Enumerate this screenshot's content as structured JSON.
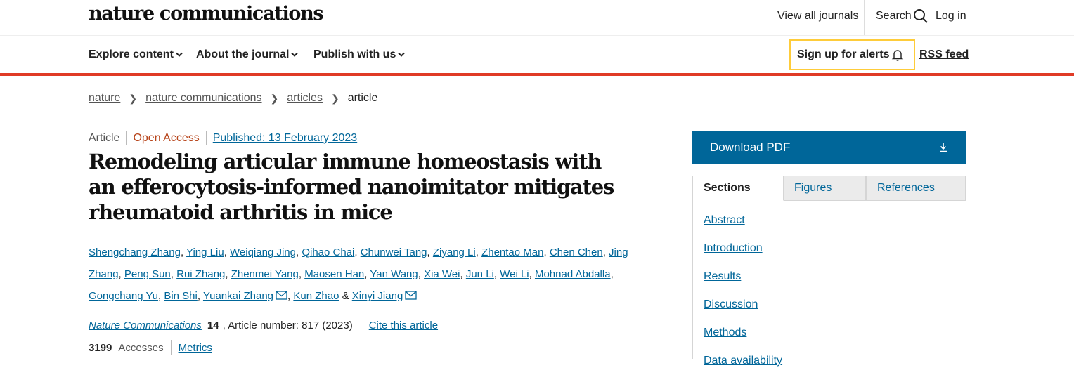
{
  "header": {
    "logo": "nature communications",
    "view_all": "View all journals",
    "search": "Search",
    "login": "Log in"
  },
  "nav": {
    "items": [
      "Explore content",
      "About the journal",
      "Publish with us"
    ],
    "alerts": "Sign up for alerts",
    "rss": "RSS feed"
  },
  "breadcrumb": [
    "nature",
    "nature communications",
    "articles",
    "article"
  ],
  "article": {
    "type": "Article",
    "access": "Open Access",
    "published": "Published: 13 February 2023",
    "title": "Remodeling articular immune homeostasis with an efferocytosis-informed nanoimitator mitigates rheumatoid arthritis in mice",
    "authors": [
      {
        "name": "Shengchang Zhang",
        "sep": ", "
      },
      {
        "name": "Ying Liu",
        "sep": ", "
      },
      {
        "name": "Weiqiang Jing",
        "sep": ", "
      },
      {
        "name": "Qihao Chai",
        "sep": ", "
      },
      {
        "name": "Chunwei Tang",
        "sep": ", "
      },
      {
        "name": "Ziyang Li",
        "sep": ", "
      },
      {
        "name": "Zhentao Man",
        "sep": ", "
      },
      {
        "name": "Chen Chen",
        "sep": ", "
      },
      {
        "name": "Jing Zhang",
        "sep": ", "
      },
      {
        "name": "Peng Sun",
        "sep": ", "
      },
      {
        "name": "Rui Zhang",
        "sep": ", "
      },
      {
        "name": "Zhenmei Yang",
        "sep": ", "
      },
      {
        "name": "Maosen Han",
        "sep": ", "
      },
      {
        "name": "Yan Wang",
        "sep": ", "
      },
      {
        "name": "Xia Wei",
        "sep": ", "
      },
      {
        "name": "Jun Li",
        "sep": ", "
      },
      {
        "name": "Wei Li",
        "sep": ", "
      },
      {
        "name": "Mohnad Abdalla",
        "sep": ", "
      },
      {
        "name": "Gongchang Yu",
        "sep": ", "
      },
      {
        "name": "Bin Shi",
        "sep": ", "
      },
      {
        "name": "Yuankai Zhang",
        "sep": ", ",
        "email": true
      },
      {
        "name": "Kun Zhao",
        "sep": " & "
      },
      {
        "name": "Xinyi Jiang",
        "sep": "",
        "email": true
      }
    ],
    "journal": "Nature Communications",
    "volume": "14",
    "article_number": ", Article number: 817 (2023)",
    "cite": "Cite this article",
    "accesses_count": "3199",
    "accesses_label": "Accesses",
    "metrics": "Metrics"
  },
  "sidebar": {
    "download": "Download PDF",
    "tabs": [
      "Sections",
      "Figures",
      "References"
    ],
    "sections": [
      "Abstract",
      "Introduction",
      "Results",
      "Discussion",
      "Methods",
      "Data availability"
    ]
  },
  "colors": {
    "link": "#006699",
    "accent_red": "#e03b26",
    "alert_border": "#fecc3a",
    "download_bg": "#006699",
    "open_access": "#b7441a"
  }
}
